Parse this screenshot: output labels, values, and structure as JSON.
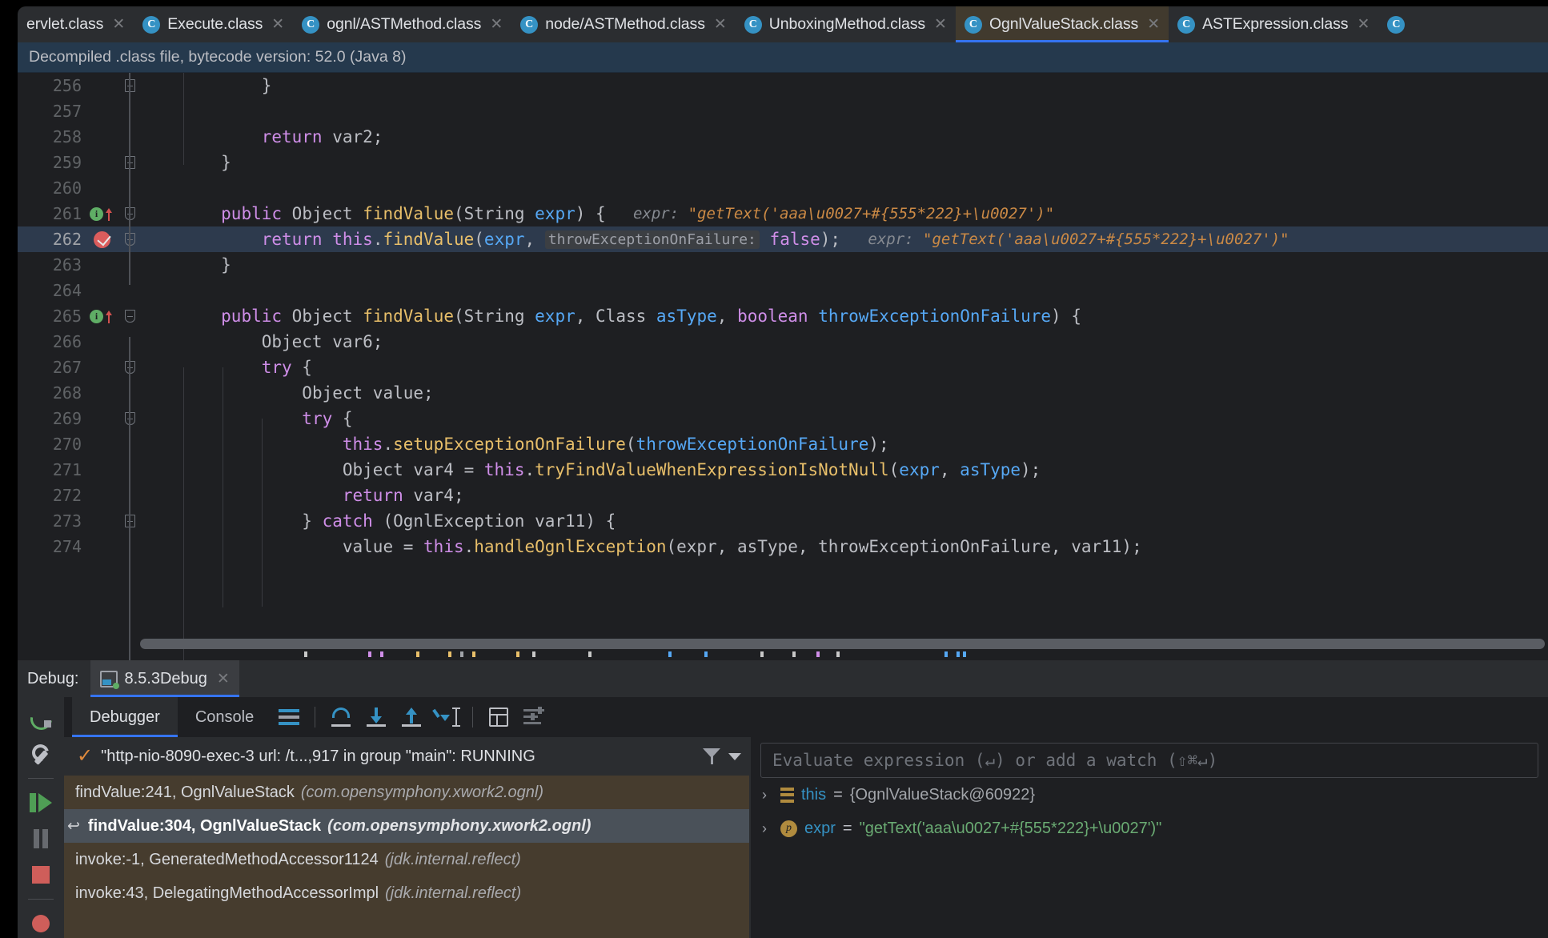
{
  "editor_tabs": [
    {
      "label": "ervlet.class",
      "icon": "class-icon",
      "active": false,
      "truncated": true
    },
    {
      "label": "Execute.class",
      "icon": "class-icon",
      "active": false
    },
    {
      "label": "ognl/ASTMethod.class",
      "icon": "class-icon",
      "active": false
    },
    {
      "label": "node/ASTMethod.class",
      "icon": "class-icon",
      "active": false
    },
    {
      "label": "UnboxingMethod.class",
      "icon": "class-icon",
      "active": false
    },
    {
      "label": "OgnlValueStack.class",
      "icon": "class-icon",
      "active": true
    },
    {
      "label": "ASTExpression.class",
      "icon": "class-icon",
      "active": false
    }
  ],
  "notification": {
    "text": "Decompiled .class file, bytecode version: 52.0 (Java 8)",
    "background": "#25394d"
  },
  "code": {
    "lines": [
      {
        "num": "256",
        "fold": "end",
        "tokens": [
          {
            "t": "            }",
            "c": "pln"
          }
        ]
      },
      {
        "num": "257",
        "tokens": []
      },
      {
        "num": "258",
        "tokens": [
          {
            "t": "            ",
            "c": "pln"
          },
          {
            "t": "return",
            "c": "kw"
          },
          {
            "t": " var2;",
            "c": "pln"
          }
        ]
      },
      {
        "num": "259",
        "fold": "end",
        "tokens": [
          {
            "t": "        }",
            "c": "pln"
          }
        ]
      },
      {
        "num": "260",
        "tokens": []
      },
      {
        "num": "261",
        "gutter": "run-marker",
        "fold": "start",
        "tokens": [
          {
            "t": "        ",
            "c": "pln"
          },
          {
            "t": "public",
            "c": "kw"
          },
          {
            "t": " ",
            "c": "pln"
          },
          {
            "t": "Object",
            "c": "typ"
          },
          {
            "t": " ",
            "c": "pln"
          },
          {
            "t": "findValue",
            "c": "mth"
          },
          {
            "t": "(",
            "c": "pln"
          },
          {
            "t": "String",
            "c": "typ"
          },
          {
            "t": " ",
            "c": "pln"
          },
          {
            "t": "expr",
            "c": "par"
          },
          {
            "t": ") {",
            "c": "pln"
          }
        ],
        "hint": "expr:",
        "hint_value": "\"getText('aaa\\u0027+#{555*222}+\\u0027')\""
      },
      {
        "num": "262",
        "gutter": "breakpoint-hit",
        "fold": "start-small",
        "highlight": true,
        "tokens": [
          {
            "t": "            ",
            "c": "pln"
          },
          {
            "t": "return",
            "c": "kw"
          },
          {
            "t": " ",
            "c": "pln"
          },
          {
            "t": "this",
            "c": "kw"
          },
          {
            "t": ".",
            "c": "pln"
          },
          {
            "t": "findValue",
            "c": "mth"
          },
          {
            "t": "(",
            "c": "pln"
          },
          {
            "t": "expr",
            "c": "par"
          },
          {
            "t": ", ",
            "c": "pln"
          }
        ],
        "param_hint": "throwExceptionOnFailure:",
        "tokens2": [
          {
            "t": " ",
            "c": "pln"
          },
          {
            "t": "false",
            "c": "kw"
          },
          {
            "t": ");",
            "c": "pln"
          }
        ],
        "hint": "expr:",
        "hint_value": "\"getText('aaa\\u0027+#{555*222}+\\u0027')\""
      },
      {
        "num": "263",
        "tokens": [
          {
            "t": "        }",
            "c": "pln"
          }
        ]
      },
      {
        "num": "264",
        "tokens": []
      },
      {
        "num": "265",
        "gutter": "run-marker",
        "fold": "start",
        "tokens": [
          {
            "t": "        ",
            "c": "pln"
          },
          {
            "t": "public",
            "c": "kw"
          },
          {
            "t": " ",
            "c": "pln"
          },
          {
            "t": "Object",
            "c": "typ"
          },
          {
            "t": " ",
            "c": "pln"
          },
          {
            "t": "findValue",
            "c": "mth"
          },
          {
            "t": "(",
            "c": "pln"
          },
          {
            "t": "String",
            "c": "typ"
          },
          {
            "t": " ",
            "c": "pln"
          },
          {
            "t": "expr",
            "c": "par"
          },
          {
            "t": ", ",
            "c": "pln"
          },
          {
            "t": "Class",
            "c": "typ"
          },
          {
            "t": " ",
            "c": "pln"
          },
          {
            "t": "asType",
            "c": "par"
          },
          {
            "t": ", ",
            "c": "pln"
          },
          {
            "t": "boolean",
            "c": "kw"
          },
          {
            "t": " ",
            "c": "pln"
          },
          {
            "t": "throwExceptionOnFailure",
            "c": "par"
          },
          {
            "t": ") {",
            "c": "pln"
          }
        ]
      },
      {
        "num": "266",
        "tokens": [
          {
            "t": "            ",
            "c": "pln"
          },
          {
            "t": "Object",
            "c": "typ"
          },
          {
            "t": " var6;",
            "c": "pln"
          }
        ]
      },
      {
        "num": "267",
        "fold": "start",
        "tokens": [
          {
            "t": "            ",
            "c": "pln"
          },
          {
            "t": "try",
            "c": "kw"
          },
          {
            "t": " {",
            "c": "pln"
          }
        ]
      },
      {
        "num": "268",
        "tokens": [
          {
            "t": "                ",
            "c": "pln"
          },
          {
            "t": "Object",
            "c": "typ"
          },
          {
            "t": " value;",
            "c": "pln"
          }
        ]
      },
      {
        "num": "269",
        "fold": "start",
        "tokens": [
          {
            "t": "                ",
            "c": "pln"
          },
          {
            "t": "try",
            "c": "kw"
          },
          {
            "t": " {",
            "c": "pln"
          }
        ]
      },
      {
        "num": "270",
        "tokens": [
          {
            "t": "                    ",
            "c": "pln"
          },
          {
            "t": "this",
            "c": "kw"
          },
          {
            "t": ".",
            "c": "pln"
          },
          {
            "t": "setupExceptionOnFailure",
            "c": "mth"
          },
          {
            "t": "(",
            "c": "pln"
          },
          {
            "t": "throwExceptionOnFailure",
            "c": "par"
          },
          {
            "t": ");",
            "c": "pln"
          }
        ]
      },
      {
        "num": "271",
        "tokens": [
          {
            "t": "                    ",
            "c": "pln"
          },
          {
            "t": "Object",
            "c": "typ"
          },
          {
            "t": " var4 = ",
            "c": "pln"
          },
          {
            "t": "this",
            "c": "kw"
          },
          {
            "t": ".",
            "c": "pln"
          },
          {
            "t": "tryFindValueWhenExpressionIsNotNull",
            "c": "mth"
          },
          {
            "t": "(",
            "c": "pln"
          },
          {
            "t": "expr",
            "c": "par"
          },
          {
            "t": ", ",
            "c": "pln"
          },
          {
            "t": "asType",
            "c": "par"
          },
          {
            "t": ");",
            "c": "pln"
          }
        ]
      },
      {
        "num": "272",
        "tokens": [
          {
            "t": "                    ",
            "c": "pln"
          },
          {
            "t": "return",
            "c": "kw"
          },
          {
            "t": " var4;",
            "c": "pln"
          }
        ]
      },
      {
        "num": "273",
        "fold": "end",
        "tokens": [
          {
            "t": "                } ",
            "c": "pln"
          },
          {
            "t": "catch",
            "c": "kw"
          },
          {
            "t": " (",
            "c": "pln"
          },
          {
            "t": "OgnlException",
            "c": "typ"
          },
          {
            "t": " var11) {",
            "c": "pln"
          }
        ]
      },
      {
        "num": "274",
        "clipped": true,
        "tokens": [
          {
            "t": "                    ",
            "c": "pln"
          },
          {
            "t": "value = ",
            "c": "pln"
          },
          {
            "t": "this",
            "c": "kw"
          },
          {
            "t": ".",
            "c": "pln"
          },
          {
            "t": "handleOgnlException",
            "c": "mth"
          },
          {
            "t": "(expr, asType, throwExceptionOnFailure, var11);",
            "c": "pln"
          }
        ]
      }
    ]
  },
  "debug_window": {
    "title": "Debug:",
    "run_config_tab": "8.5.3Debug",
    "close_label": "✕",
    "tabs": [
      {
        "label": "Debugger",
        "active": true
      },
      {
        "label": "Console",
        "active": false
      }
    ],
    "toolbar_icons": [
      "layers-icon",
      "step-over-icon",
      "step-into-icon",
      "step-out-icon",
      "run-to-cursor-icon",
      "evaluate-expression-icon",
      "debug-settings-icon"
    ],
    "side_icons": [
      "rerun-icon",
      "settings-wrench-icon",
      "resume-program-icon",
      "pause-program-icon",
      "stop-icon",
      "camera-icon"
    ],
    "thread": {
      "status_glyph": "✓",
      "text": "\"http-nio-8090-exec-3 url: /t...,917 in group \"main\": RUNNING",
      "filter_icon": "filter-icon",
      "dropdown_icon": "chevron-down-icon"
    },
    "frames": [
      {
        "main": "findValue:241, OgnlValueStack",
        "pkg": "(com.opensymphony.xwork2.ognl)",
        "selected": false,
        "marker": ""
      },
      {
        "main": "findValue:304, OgnlValueStack",
        "pkg": "(com.opensymphony.xwork2.ognl)",
        "selected": true,
        "marker": "↩"
      },
      {
        "main": "invoke:-1, GeneratedMethodAccessor1124",
        "pkg": "(jdk.internal.reflect)",
        "selected": false,
        "marker": ""
      },
      {
        "main": "invoke:43, DelegatingMethodAccessorImpl",
        "pkg": "(jdk.internal.reflect)",
        "selected": false,
        "marker": ""
      }
    ],
    "watch_placeholder": "Evaluate expression (↵) or add a watch (⇧⌘↵)",
    "variables": [
      {
        "chevron": "›",
        "icon": "object-icon",
        "name": "this",
        "eq": "=",
        "value": "{OgnlValueStack@60922}",
        "value_color": "#a2a5aa"
      },
      {
        "chevron": "›",
        "icon": "parameter-icon",
        "icon_letter": "p",
        "name": "expr",
        "eq": "=",
        "value": "\"getText('aaa\\u0027+#{555*222}+\\u0027')\"",
        "value_color": "#6aab73"
      }
    ]
  },
  "colors": {
    "accent_blue": "#3574f0",
    "editor_bg": "#1e1f22",
    "panel_bg": "#2b2d30",
    "frames_bg": "#463c2e",
    "active_tab_bg": "#413a2e",
    "highlight_line": "#2d3a4d",
    "notification_bg": "#25394d",
    "breakpoint_red": "#db5c5c",
    "string_green": "#6aab73",
    "method_yellow": "#e8bf6a",
    "keyword_purple": "#cf8ee8",
    "param_blue": "#56a8f5"
  }
}
